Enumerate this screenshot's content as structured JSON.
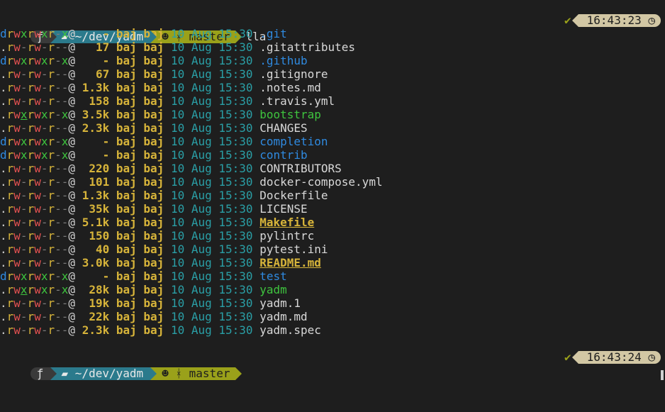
{
  "prompts": [
    {
      "os_icon": "ƒ",
      "dir": "~/dev/yadm",
      "git_icon": "☻",
      "branch_glyph": "ᚼ",
      "branch": "master",
      "command": "lla",
      "status_check": "✔",
      "time": "16:43:23",
      "clock_icon": "◷"
    },
    {
      "os_icon": "ƒ",
      "dir": "~/dev/yadm",
      "git_icon": "☻",
      "branch_glyph": "ᚼ",
      "branch": "master",
      "command": "",
      "status_check": "✔",
      "time": "16:43:24",
      "clock_icon": "◷"
    }
  ],
  "listing": [
    {
      "perm": "drwxrwxr-x@",
      "size": "-",
      "user": "baj",
      "group": "baj",
      "date": "10 Aug 15:30",
      "name": ".git",
      "kind": "dir"
    },
    {
      "perm": ".rw-rw-r--@",
      "size": "17",
      "user": "baj",
      "group": "baj",
      "date": "10 Aug 15:30",
      "name": ".gitattributes",
      "kind": "file"
    },
    {
      "perm": "drwxrwxr-x@",
      "size": "-",
      "user": "baj",
      "group": "baj",
      "date": "10 Aug 15:30",
      "name": ".github",
      "kind": "dir"
    },
    {
      "perm": ".rw-rw-r--@",
      "size": "67",
      "user": "baj",
      "group": "baj",
      "date": "10 Aug 15:30",
      "name": ".gitignore",
      "kind": "file"
    },
    {
      "perm": ".rw-rw-r--@",
      "size": "1.3k",
      "user": "baj",
      "group": "baj",
      "date": "10 Aug 15:30",
      "name": ".notes.md",
      "kind": "file"
    },
    {
      "perm": ".rw-rw-r--@",
      "size": "158",
      "user": "baj",
      "group": "baj",
      "date": "10 Aug 15:30",
      "name": ".travis.yml",
      "kind": "file"
    },
    {
      "perm": ".rwxrwxr-x@",
      "size": "3.5k",
      "user": "baj",
      "group": "baj",
      "date": "10 Aug 15:30",
      "name": "bootstrap",
      "kind": "exec"
    },
    {
      "perm": ".rw-rw-r--@",
      "size": "2.3k",
      "user": "baj",
      "group": "baj",
      "date": "10 Aug 15:30",
      "name": "CHANGES",
      "kind": "file"
    },
    {
      "perm": "drwxrwxr-x@",
      "size": "-",
      "user": "baj",
      "group": "baj",
      "date": "10 Aug 15:30",
      "name": "completion",
      "kind": "dir"
    },
    {
      "perm": "drwxrwxr-x@",
      "size": "-",
      "user": "baj",
      "group": "baj",
      "date": "10 Aug 15:30",
      "name": "contrib",
      "kind": "dir"
    },
    {
      "perm": ".rw-rw-r--@",
      "size": "220",
      "user": "baj",
      "group": "baj",
      "date": "10 Aug 15:30",
      "name": "CONTRIBUTORS",
      "kind": "file"
    },
    {
      "perm": ".rw-rw-r--@",
      "size": "101",
      "user": "baj",
      "group": "baj",
      "date": "10 Aug 15:30",
      "name": "docker-compose.yml",
      "kind": "file"
    },
    {
      "perm": ".rw-rw-r--@",
      "size": "1.3k",
      "user": "baj",
      "group": "baj",
      "date": "10 Aug 15:30",
      "name": "Dockerfile",
      "kind": "file"
    },
    {
      "perm": ".rw-rw-r--@",
      "size": "35k",
      "user": "baj",
      "group": "baj",
      "date": "10 Aug 15:30",
      "name": "LICENSE",
      "kind": "file"
    },
    {
      "perm": ".rw-rw-r--@",
      "size": "5.1k",
      "user": "baj",
      "group": "baj",
      "date": "10 Aug 15:30",
      "name": "Makefile",
      "kind": "special"
    },
    {
      "perm": ".rw-rw-r--@",
      "size": "150",
      "user": "baj",
      "group": "baj",
      "date": "10 Aug 15:30",
      "name": "pylintrc",
      "kind": "file"
    },
    {
      "perm": ".rw-rw-r--@",
      "size": "40",
      "user": "baj",
      "group": "baj",
      "date": "10 Aug 15:30",
      "name": "pytest.ini",
      "kind": "file"
    },
    {
      "perm": ".rw-rw-r--@",
      "size": "3.0k",
      "user": "baj",
      "group": "baj",
      "date": "10 Aug 15:30",
      "name": "README.md",
      "kind": "special"
    },
    {
      "perm": "drwxrwxr-x@",
      "size": "-",
      "user": "baj",
      "group": "baj",
      "date": "10 Aug 15:30",
      "name": "test",
      "kind": "dir"
    },
    {
      "perm": ".rwxrwxr-x@",
      "size": "28k",
      "user": "baj",
      "group": "baj",
      "date": "10 Aug 15:30",
      "name": "yadm",
      "kind": "exec"
    },
    {
      "perm": ".rw-rw-r--@",
      "size": "19k",
      "user": "baj",
      "group": "baj",
      "date": "10 Aug 15:30",
      "name": "yadm.1",
      "kind": "file"
    },
    {
      "perm": ".rw-rw-r--@",
      "size": "22k",
      "user": "baj",
      "group": "baj",
      "date": "10 Aug 15:30",
      "name": "yadm.md",
      "kind": "file"
    },
    {
      "perm": ".rw-rw-r--@",
      "size": "2.3k",
      "user": "baj",
      "group": "baj",
      "date": "10 Aug 15:30",
      "name": "yadm.spec",
      "kind": "file"
    }
  ],
  "colors": {
    "background": "#1e1e1e",
    "dir_segment": "#2b7a8c",
    "git_segment": "#9aa11a",
    "time_segment": "#d2c7a4",
    "directory": "#2f8ae0",
    "executable": "#3ec43e",
    "size_owner": "#d7b43a",
    "date": "#2a9fa6"
  }
}
